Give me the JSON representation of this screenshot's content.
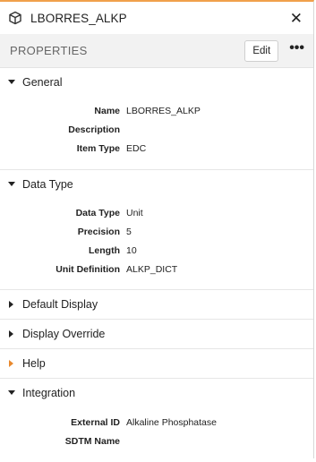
{
  "header": {
    "title": "LBORRES_ALKP",
    "icon": "cube-icon",
    "close_glyph": "✕"
  },
  "properties_bar": {
    "label": "PROPERTIES",
    "edit_label": "Edit",
    "more_glyph": "•••"
  },
  "sections": {
    "general": {
      "title": "General",
      "expanded": true,
      "rows": [
        {
          "key": "Name",
          "value": "LBORRES_ALKP"
        },
        {
          "key": "Description",
          "value": ""
        },
        {
          "key": "Item Type",
          "value": "EDC"
        }
      ]
    },
    "data_type": {
      "title": "Data Type",
      "expanded": true,
      "rows": [
        {
          "key": "Data Type",
          "value": "Unit"
        },
        {
          "key": "Precision",
          "value": "5"
        },
        {
          "key": "Length",
          "value": "10"
        },
        {
          "key": "Unit Definition",
          "value": "ALKP_DICT"
        }
      ]
    },
    "default_display": {
      "title": "Default Display",
      "expanded": false
    },
    "display_override": {
      "title": "Display Override",
      "expanded": false
    },
    "help": {
      "title": "Help",
      "expanded": false,
      "accent": "#e8892e"
    },
    "integration": {
      "title": "Integration",
      "expanded": true,
      "rows": [
        {
          "key": "External ID",
          "value": "Alkaline Phosphatase"
        },
        {
          "key": "SDTM Name",
          "value": ""
        }
      ]
    }
  },
  "colors": {
    "top_accent": "#f0a04b",
    "help_caret": "#e8892e"
  }
}
